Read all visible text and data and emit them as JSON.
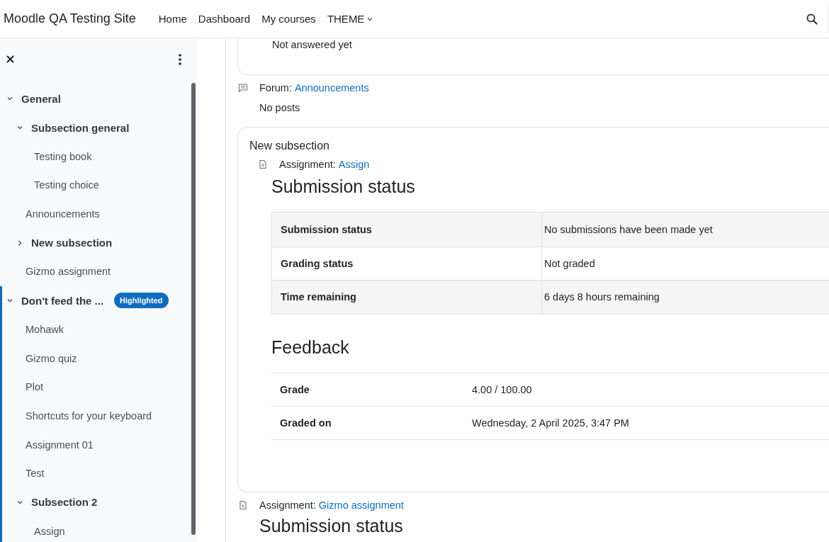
{
  "header": {
    "site_name": "Moodle QA Testing Site",
    "nav": [
      {
        "label": "Home",
        "dropdown": false
      },
      {
        "label": "Dashboard",
        "dropdown": false
      },
      {
        "label": "My courses",
        "dropdown": false
      },
      {
        "label": "THEME",
        "dropdown": true
      }
    ]
  },
  "course_index": {
    "items": [
      {
        "kind": "section",
        "label": "General",
        "expanded": true,
        "current": false,
        "children": [
          {
            "kind": "subsection",
            "label": "Subsection general",
            "expanded": true,
            "children": [
              {
                "kind": "activity",
                "label": "Testing book"
              },
              {
                "kind": "activity",
                "label": "Testing choice"
              }
            ]
          },
          {
            "kind": "activity",
            "label": "Announcements"
          },
          {
            "kind": "subsection",
            "label": "New subsection",
            "expanded": false
          },
          {
            "kind": "activity",
            "label": "Gizmo assignment"
          }
        ]
      },
      {
        "kind": "section",
        "label": "Don't feed the ...",
        "badge": "Highlighted",
        "expanded": true,
        "current": true,
        "children": [
          {
            "kind": "activity",
            "label": "Mohawk"
          },
          {
            "kind": "activity",
            "label": "Gizmo quiz"
          },
          {
            "kind": "activity",
            "label": "Plot"
          },
          {
            "kind": "activity",
            "label": "Shortcuts for your keyboard"
          },
          {
            "kind": "activity",
            "label": "Assignment 01"
          },
          {
            "kind": "activity",
            "label": "Test"
          },
          {
            "kind": "subsection",
            "label": "Subsection 2",
            "expanded": true,
            "children": [
              {
                "kind": "activity",
                "label": "Assign"
              }
            ]
          }
        ]
      }
    ]
  },
  "content": {
    "top_card": {
      "text": "Not answered yet"
    },
    "forum": {
      "kind": "forum",
      "type_label": "Forum:",
      "link": "Announcements",
      "status": "No posts"
    },
    "subsection_card": {
      "title": "New subsection",
      "activity": {
        "kind": "assignment",
        "type_label": "Assignment:",
        "link": "Assign"
      },
      "submission": {
        "heading": "Submission status",
        "rows": [
          {
            "label": "Submission status",
            "value": "No submissions have been made yet"
          },
          {
            "label": "Grading status",
            "value": "Not graded"
          },
          {
            "label": "Time remaining",
            "value": "6 days 8 hours remaining"
          }
        ]
      },
      "feedback": {
        "heading": "Feedback",
        "rows": [
          {
            "label": "Grade",
            "value": "4.00 / 100.00"
          },
          {
            "label": "Graded on",
            "value": "Wednesday, 2 April 2025, 3:47 PM"
          }
        ]
      }
    },
    "trailing_activity": {
      "kind": "assignment",
      "type_label": "Assignment:",
      "link": "Gizmo assignment",
      "heading": "Submission status"
    }
  }
}
